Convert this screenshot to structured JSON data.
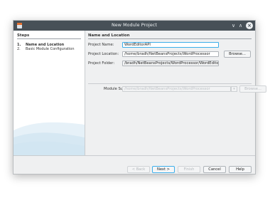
{
  "window": {
    "title": "New Module Project",
    "minimize_glyph": "∨",
    "maximize_glyph": "∧",
    "close_glyph": "×"
  },
  "steps": {
    "heading": "Steps",
    "items": [
      {
        "number": "1.",
        "label": "Name and Location"
      },
      {
        "number": "2.",
        "label": "Basic Module Configuration"
      }
    ]
  },
  "panel": {
    "title": "Name and Location",
    "project_name_label": "Project Name:",
    "project_name_value": "WordEditorAPI",
    "project_location_label": "Project Location:",
    "project_location_value": "/home/bradh/NetBeansProjects/WordProcessor",
    "browse_label": "Browse...",
    "project_folder_label": "Project Folder:",
    "project_folder_value": "/bradh/NetBeansProjects/WordProcessor/WordEditorAPI",
    "module_suite_label": "Module Suite:",
    "module_suite_value": "/home/bradh/NetBeansProjects/WordProcessor",
    "module_suite_browse_label": "Browse...",
    "combo_arrow_glyph": "▾"
  },
  "footer": {
    "back_label": "< Back",
    "next_label": "Next >",
    "finish_label": "Finish",
    "cancel_label": "Cancel",
    "help_label": "Help"
  },
  "colors": {
    "titlebar": "#475057",
    "focus_accent": "#3daee9",
    "step_swoosh": "#b7d7ea"
  }
}
